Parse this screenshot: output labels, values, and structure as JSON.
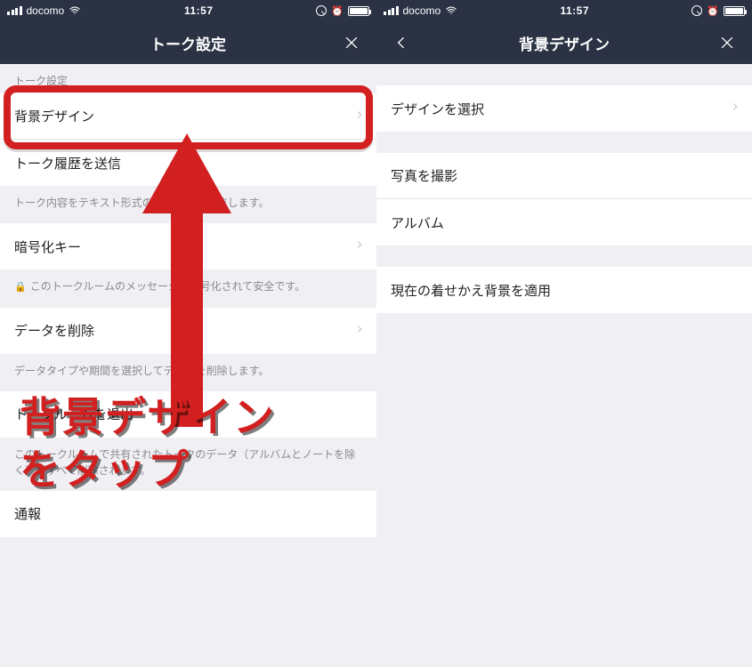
{
  "status": {
    "carrier": "docomo",
    "time": "11:57"
  },
  "left": {
    "header_title": "トーク設定",
    "section1_label": "トーク設定",
    "row_bg_design": "背景デザイン",
    "row_send_history": "トーク履歴を送信",
    "helper_send_history": "トーク内容をテキスト形式のファイルで送信します。",
    "row_enc_key": "暗号化キー",
    "helper_enc_key": "このトークルームのメッセージは暗号化されて安全です。",
    "row_delete": "データを削除",
    "helper_delete": "データタイプや期間を選択してデータを削除します。",
    "row_leave": "トークルームを退出",
    "helper_leave": "このトークルームで共有されたトークのデータ（アルバムとノートを除く）がすべて削除されます。",
    "row_report": "通報"
  },
  "right": {
    "header_title": "背景デザイン",
    "row_select_design": "デザインを選択",
    "row_take_photo": "写真を撮影",
    "row_album": "アルバム",
    "row_apply_current": "現在の着せかえ背景を適用"
  },
  "annotation": {
    "callout": "背景デザイン\nをタップ"
  }
}
